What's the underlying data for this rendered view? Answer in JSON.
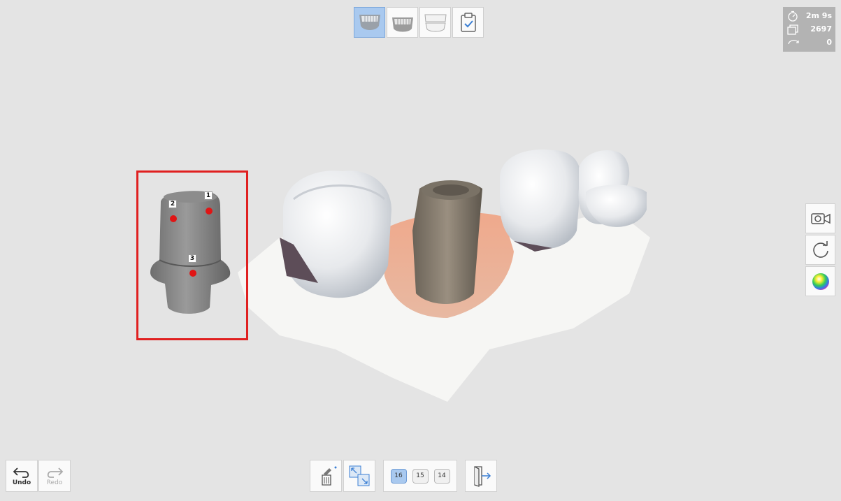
{
  "stage_tabs": [
    {
      "name": "upper-jaw",
      "active": true
    },
    {
      "name": "lower-jaw",
      "active": false
    },
    {
      "name": "occlusion",
      "active": false
    },
    {
      "name": "checklist",
      "active": false
    }
  ],
  "scan_info": {
    "time": "2m 9s",
    "frames": "2697",
    "rotations": "0"
  },
  "side_tools": [
    "video-camera-icon",
    "rotate-icon",
    "color-map-icon"
  ],
  "history": {
    "undo_label": "Undo",
    "redo_label": "Redo"
  },
  "tools": [
    "trim-icon",
    "fit-view-icon",
    "exit-icon"
  ],
  "tooth_numbers": [
    {
      "num": "16",
      "active": true
    },
    {
      "num": "15",
      "active": false
    },
    {
      "num": "14",
      "active": false
    }
  ],
  "alignment_points": [
    "1",
    "2",
    "3"
  ],
  "colors": {
    "active_blue": "#a9c9ef",
    "highlight_red": "#e02020",
    "point_red": "#e01515"
  }
}
